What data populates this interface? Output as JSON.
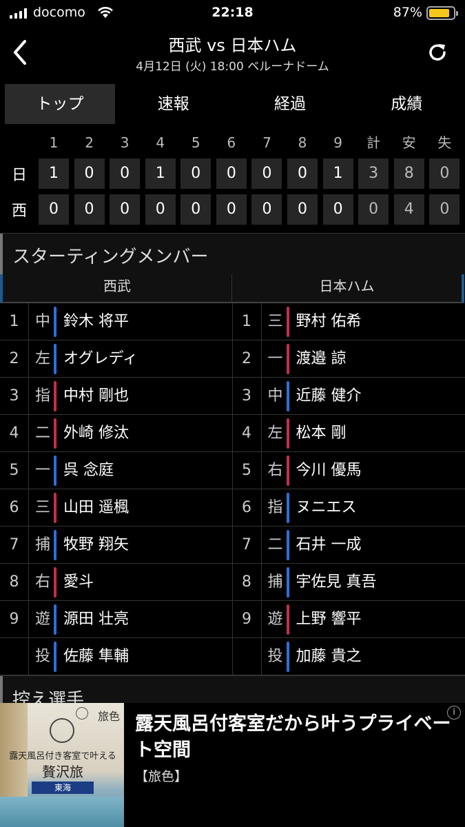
{
  "status_bar": {
    "carrier": "docomo",
    "time": "22:18",
    "battery": "87%"
  },
  "header": {
    "title": "西武 vs 日本ハム",
    "subtitle": "4月12日 (火) 18:00 ベルーナドーム"
  },
  "tabs": [
    "トップ",
    "速報",
    "経過",
    "成績"
  ],
  "scoreboard": {
    "headers": [
      "1",
      "2",
      "3",
      "4",
      "5",
      "6",
      "7",
      "8",
      "9",
      "計",
      "安",
      "失"
    ],
    "rows": [
      {
        "team": "日",
        "cells": [
          "1",
          "0",
          "0",
          "1",
          "0",
          "0",
          "0",
          "0",
          "1",
          "3",
          "8",
          "0"
        ]
      },
      {
        "team": "西",
        "cells": [
          "0",
          "0",
          "0",
          "0",
          "0",
          "0",
          "0",
          "0",
          "0",
          "0",
          "4",
          "0"
        ]
      }
    ]
  },
  "lineup": {
    "section_title": "スターティングメンバー",
    "home_team": "西武",
    "away_team": "日本ハム",
    "rows": [
      {
        "l_num": "1",
        "l_pos": "中",
        "l_name": "鈴木 将平",
        "l_hand": "b",
        "r_num": "1",
        "r_pos": "三",
        "r_name": "野村 佑希",
        "r_hand": "r"
      },
      {
        "l_num": "2",
        "l_pos": "左",
        "l_name": "オグレディ",
        "l_hand": "b",
        "r_num": "2",
        "r_pos": "一",
        "r_name": "渡邉 諒",
        "r_hand": "r"
      },
      {
        "l_num": "3",
        "l_pos": "指",
        "l_name": "中村 剛也",
        "l_hand": "r",
        "r_num": "3",
        "r_pos": "中",
        "r_name": "近藤 健介",
        "r_hand": "b"
      },
      {
        "l_num": "4",
        "l_pos": "二",
        "l_name": "外崎 修汰",
        "l_hand": "r",
        "r_num": "4",
        "r_pos": "左",
        "r_name": "松本 剛",
        "r_hand": "r"
      },
      {
        "l_num": "5",
        "l_pos": "一",
        "l_name": "呉 念庭",
        "l_hand": "b",
        "r_num": "5",
        "r_pos": "右",
        "r_name": "今川 優馬",
        "r_hand": "r"
      },
      {
        "l_num": "6",
        "l_pos": "三",
        "l_name": "山田 遥楓",
        "l_hand": "r",
        "r_num": "6",
        "r_pos": "指",
        "r_name": "ヌニエス",
        "r_hand": "b"
      },
      {
        "l_num": "7",
        "l_pos": "捕",
        "l_name": "牧野 翔矢",
        "l_hand": "b",
        "r_num": "7",
        "r_pos": "二",
        "r_name": "石井 一成",
        "r_hand": "b"
      },
      {
        "l_num": "8",
        "l_pos": "右",
        "l_name": "愛斗",
        "l_hand": "r",
        "r_num": "8",
        "r_pos": "捕",
        "r_name": "宇佐見 真吾",
        "r_hand": "b"
      },
      {
        "l_num": "9",
        "l_pos": "遊",
        "l_name": "源田 壮亮",
        "l_hand": "b",
        "r_num": "9",
        "r_pos": "遊",
        "r_name": "上野 響平",
        "r_hand": "r"
      },
      {
        "l_num": "",
        "l_pos": "投",
        "l_name": "佐藤 隼輔",
        "l_hand": "b",
        "r_num": "",
        "r_pos": "投",
        "r_name": "加藤 貴之",
        "r_hand": "b"
      }
    ],
    "reserve_title": "控え選手"
  },
  "ad": {
    "brand": "旅色",
    "image_copy_1": "露天風呂付き客室で叶える",
    "image_copy_2": "贅沢旅",
    "image_tag": "東海",
    "title": "露天風呂付客室だから叶うプライベート空間",
    "source": "【旅色】",
    "info_icon": "i"
  }
}
